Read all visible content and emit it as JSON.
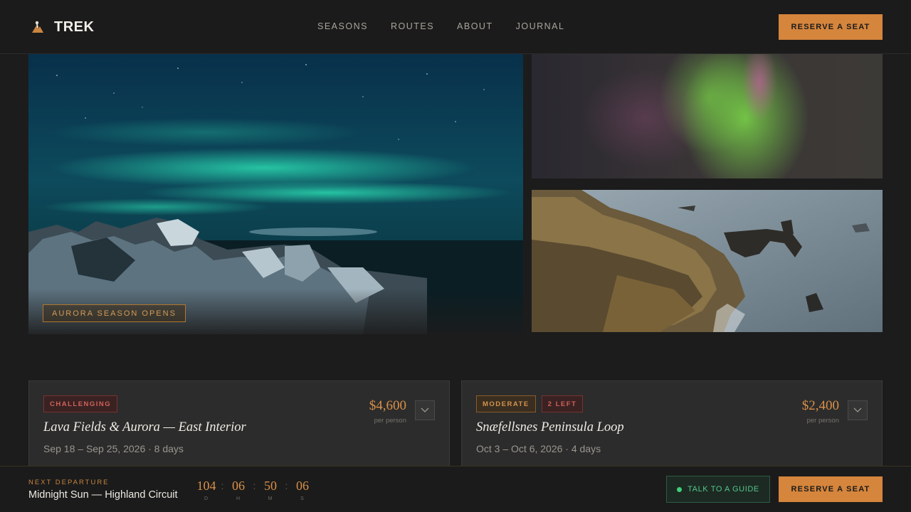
{
  "header": {
    "brand": "TREK",
    "nav": [
      "SEASONS",
      "ROUTES",
      "ABOUT",
      "JOURNAL"
    ],
    "cta": "RESERVE A SEAT"
  },
  "hero": {
    "tag": "AURORA SEASON OPENS"
  },
  "cards": [
    {
      "badges": [
        "CHALLENGING"
      ],
      "title": "Lava Fields & Aurora — East Interior",
      "dates": "Sep 18 – Sep 25, 2026 · 8 days",
      "price": "$4,600",
      "per": "per person"
    },
    {
      "badges": [
        "MODERATE",
        "2 LEFT"
      ],
      "title": "Snæfellsnes Peninsula Loop",
      "dates": "Oct 3 – Oct 6, 2026 · 4 days",
      "price": "$2,400",
      "per": "per person"
    }
  ],
  "bottom": {
    "label": "NEXT DEPARTURE",
    "name": "Midnight Sun — Highland Circuit",
    "countdown": [
      {
        "value": "104",
        "unit": "D"
      },
      {
        "value": "06",
        "unit": "H"
      },
      {
        "value": "50",
        "unit": "M"
      },
      {
        "value": "06",
        "unit": "S"
      }
    ],
    "separator": ":",
    "talk": "TALK TO A GUIDE",
    "cta": "RESERVE A SEAT"
  },
  "colors": {
    "accent": "#d5853c",
    "background": "#1c1c1c",
    "card": "#2c2c2c",
    "danger": "#d0615b",
    "online": "#3fcf7a"
  },
  "icons": [
    "brand-hiker-icon",
    "chevron-down-icon",
    "online-dot-icon"
  ]
}
